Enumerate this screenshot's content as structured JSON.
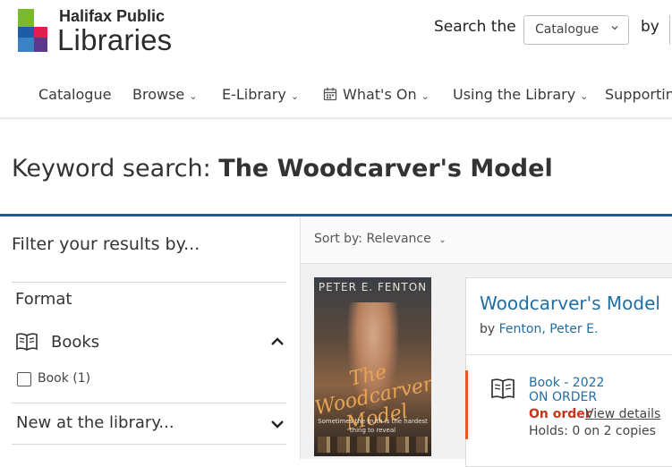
{
  "header": {
    "logo_line1": "Halifax Public",
    "logo_line2": "Libraries",
    "search_label": "Search the",
    "search_select_value": "Catalogue",
    "by_label": "by"
  },
  "nav": {
    "items": [
      "Catalogue",
      "Browse",
      "E-Library",
      "What's On",
      "Using the Library",
      "Supportin"
    ]
  },
  "page": {
    "heading_prefix": "Keyword search:",
    "heading_query": "The Woodcarver's Model"
  },
  "sidebar": {
    "title": "Filter your results by...",
    "format_label": "Format",
    "books_label": "Books",
    "book_checkbox_label": "Book (1)",
    "new_label": "New at the library..."
  },
  "results": {
    "sort_label": "Sort by: Relevance",
    "items": [
      {
        "cover_author": "PETER E. FENTON",
        "cover_title": "The Woodcarver's Model",
        "cover_tagline": "Sometimes the truth is the hardest thing to reveal",
        "title": "Woodcarver's Model",
        "by": "by",
        "author": "Fenton, Peter E.",
        "format": "Book - 2022",
        "status": "ON ORDER",
        "availability": "On order",
        "view_details": "View details",
        "holds": "Holds: 0 on 2 copies"
      }
    ]
  },
  "colors": {
    "accent_blue": "#1e5b94",
    "link_blue": "#1f6ea3",
    "on_order_red": "#c7361b",
    "availability_bar": "#e45b1b"
  }
}
